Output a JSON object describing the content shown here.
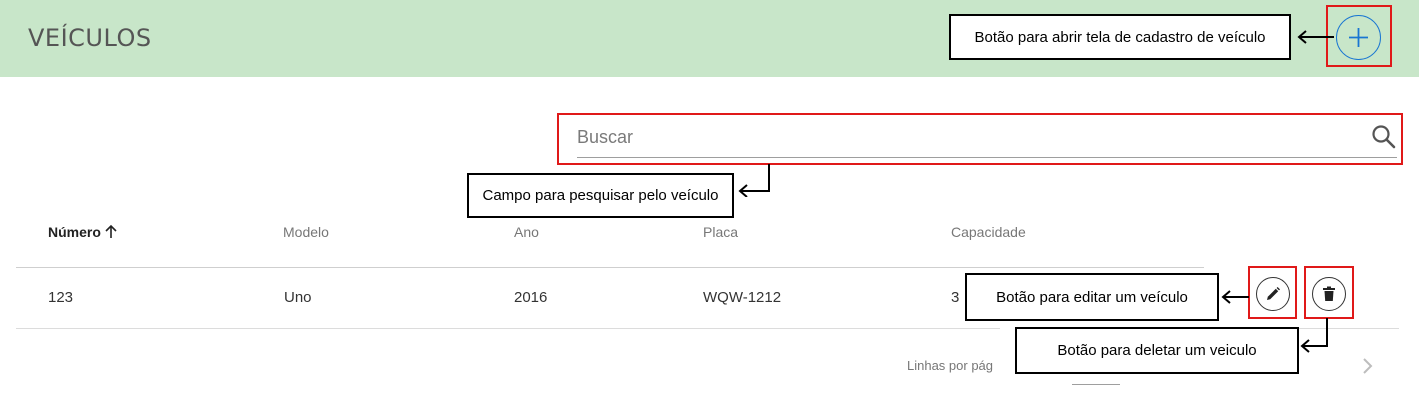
{
  "header": {
    "title": "VEÍCULOS",
    "add_button_icon": "plus-icon",
    "accent": "#1976d2",
    "background": "#c8e6c9"
  },
  "search": {
    "placeholder": "Buscar",
    "value": "",
    "icon": "search-icon"
  },
  "table": {
    "columns": [
      "Número",
      "Modelo",
      "Ano",
      "Placa",
      "Capacidade"
    ],
    "sort_icon": "arrow-up-icon",
    "rows": [
      {
        "numero": "123",
        "modelo": "Uno",
        "ano": "2016",
        "placa": "WQW-1212",
        "capacidade": "3",
        "edit_icon": "pencil-icon",
        "delete_icon": "trash-icon"
      }
    ]
  },
  "footer": {
    "rows_per_page_label": "Linhas por pág",
    "next_icon": "chevron-right-icon"
  },
  "annotations": {
    "add": "Botão para abrir tela de cadastro de veículo",
    "search": "Campo para pesquisar pelo veículo",
    "edit": "Botão para editar um veículo",
    "delete": "Botão para deletar um veiculo",
    "highlight_color": "#e01919"
  }
}
